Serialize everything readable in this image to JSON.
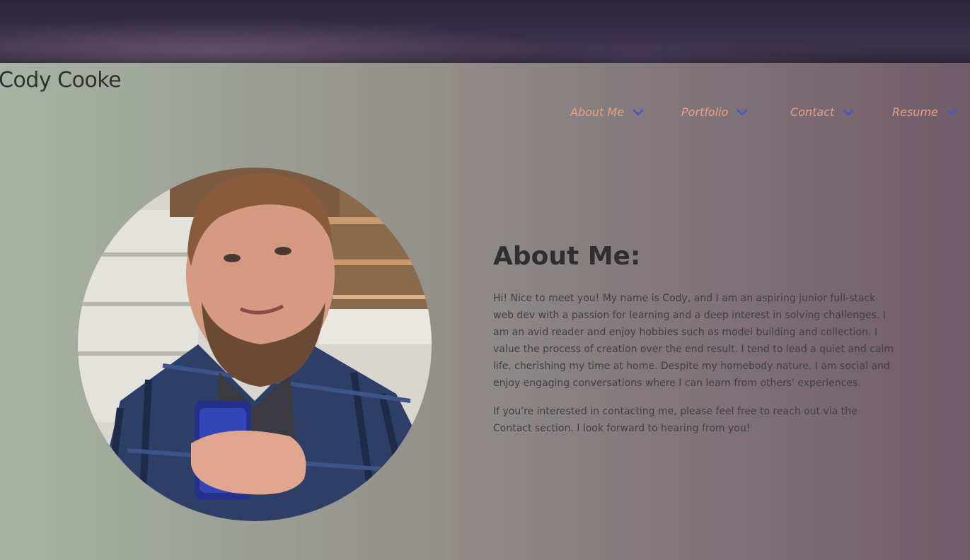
{
  "header": {
    "site_title": "Cody Cooke"
  },
  "nav": {
    "items": [
      {
        "label": "About Me",
        "icon": "chevron-down-icon"
      },
      {
        "label": "Portfolio",
        "icon": "chevron-down-icon"
      },
      {
        "label": "Contact",
        "icon": "chevron-down-icon"
      },
      {
        "label": "Resume",
        "icon": "chevron-down-icon"
      }
    ]
  },
  "about": {
    "heading": "About Me:",
    "paragraph_1": "Hi! Nice to meet you! My name is Cody, and I am an aspiring junior full-stack web dev with a passion for learning and a deep interest in solving challenges. I am an avid reader and enjoy hobbies such as model building and collection. I value the process of creation over the end result. I tend to lead a quiet and calm life, cherishing my time at home. Despite my homebody nature, I am social and enjoy engaging conversations where I can learn from others' experiences.",
    "paragraph_2": "If you're interested in contacting me, please feel free to reach out via the Contact section. I look forward to hearing from you!"
  },
  "colors": {
    "nav_text": "#e8a184",
    "chevron": "#4557c9",
    "heading": "#2f2f31",
    "body_text": "#3f3f46",
    "banner": "#2a2638"
  }
}
